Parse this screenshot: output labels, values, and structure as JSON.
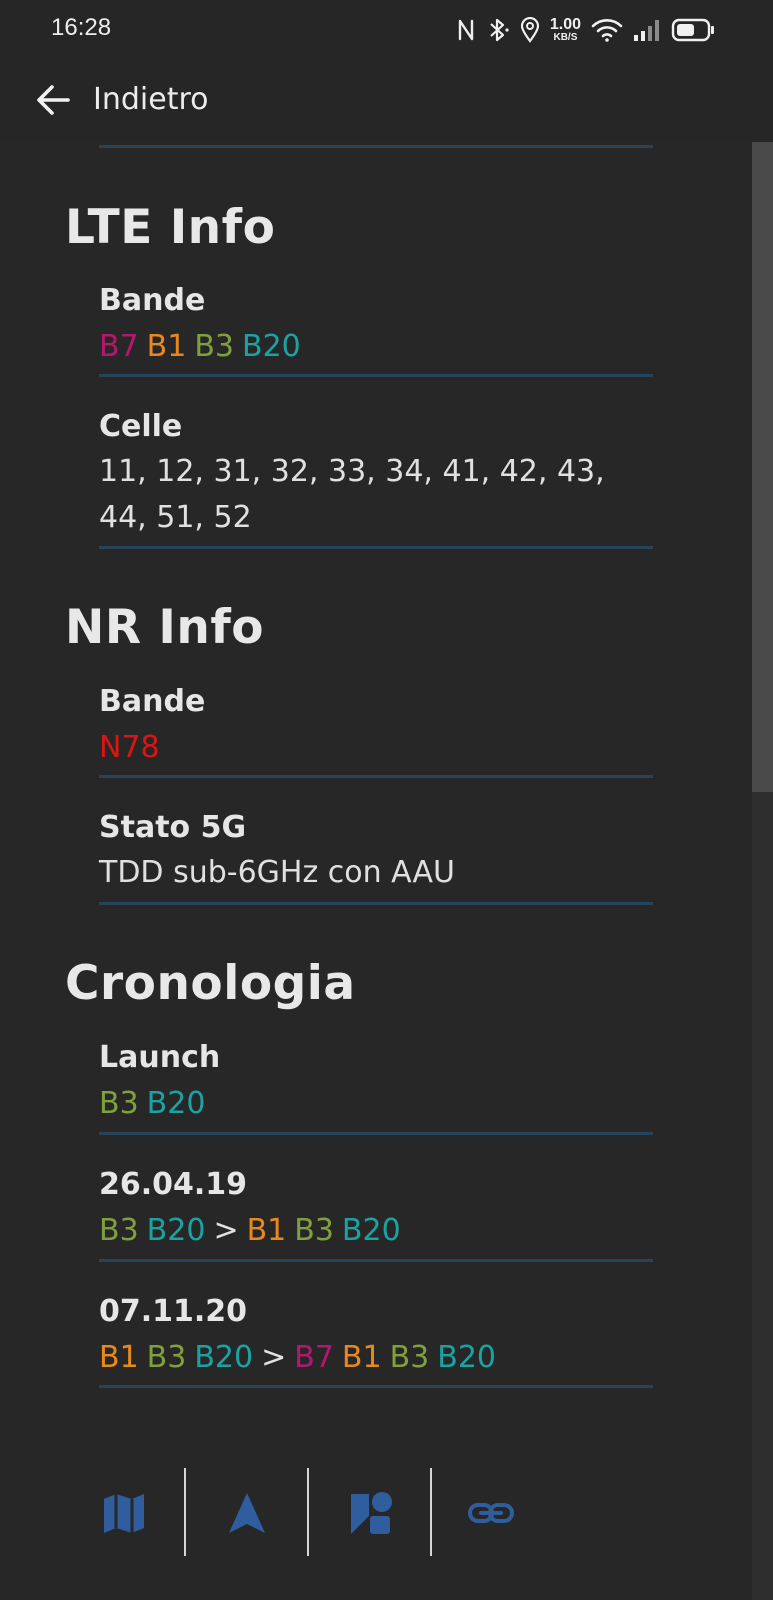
{
  "status_bar": {
    "time": "16:28",
    "net_speed_value": "1.00",
    "net_speed_unit": "KB/S",
    "icons": [
      "nfc-icon",
      "bluetooth-icon",
      "location-icon",
      "wifi-icon",
      "signal-icon",
      "battery-icon"
    ]
  },
  "nav": {
    "back_label": "Indietro",
    "back_icon": "arrow-left-icon"
  },
  "colors": {
    "B7": "#b4186e",
    "B1": "#e8891e",
    "B3": "#7fa03c",
    "B20": "#1aa3a3",
    "N78": "#d91515",
    "separator": "#27445a",
    "icon": "#2f5d9e"
  },
  "lte": {
    "title": "LTE Info",
    "bands_label": "Bande",
    "bands": [
      "B7",
      "B1",
      "B3",
      "B20"
    ],
    "cells_label": "Celle",
    "cells": "11, 12, 31, 32, 33, 34, 41, 42, 43, 44, 51, 52"
  },
  "nr": {
    "title": "NR Info",
    "bands_label": "Bande",
    "bands": [
      "N78"
    ],
    "status_label": "Stato 5G",
    "status_value": "TDD sub-6GHz con AAU"
  },
  "history": {
    "title": "Cronologia",
    "entries": [
      {
        "label": "Launch",
        "from": [
          "B3",
          "B20"
        ],
        "to": []
      },
      {
        "label": "26.04.19",
        "from": [
          "B3",
          "B20"
        ],
        "to": [
          "B1",
          "B3",
          "B20"
        ]
      },
      {
        "label": "07.11.20",
        "from": [
          "B1",
          "B3",
          "B20"
        ],
        "to": [
          "B7",
          "B1",
          "B3",
          "B20"
        ]
      }
    ],
    "arrow": ">"
  },
  "bottom_bar": {
    "icons": [
      "map-icon",
      "navigation-icon",
      "shapes-icon",
      "link-icon"
    ]
  }
}
